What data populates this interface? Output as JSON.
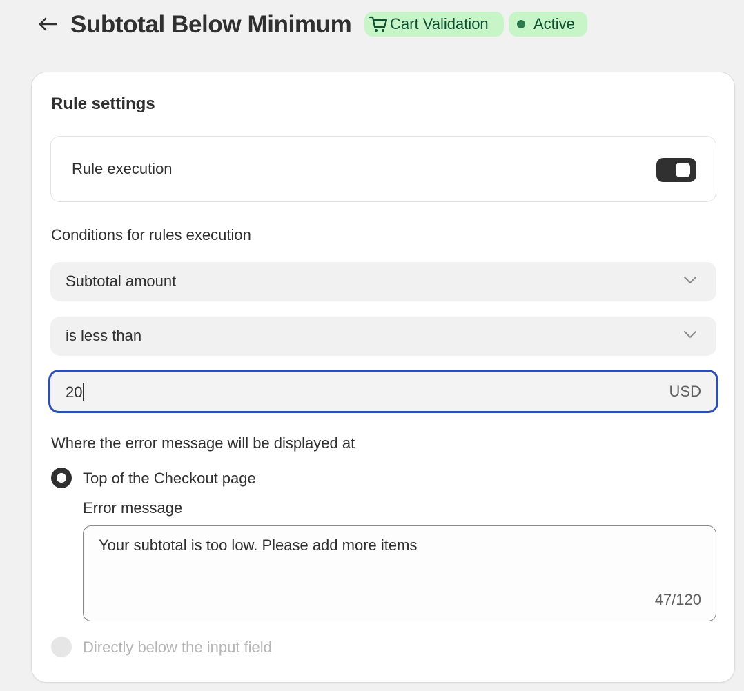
{
  "header": {
    "title": "Subtotal Below Minimum",
    "badges": {
      "type_label": "Cart Validation",
      "status_label": "Active"
    }
  },
  "card": {
    "title": "Rule settings",
    "rule_execution": {
      "label": "Rule execution",
      "enabled": true
    },
    "conditions": {
      "label": "Conditions for rules execution",
      "field_select": "Subtotal amount",
      "operator_select": "is less than",
      "amount_value": "20",
      "amount_suffix": "USD"
    },
    "display": {
      "label": "Where the error message will be displayed at",
      "options": [
        {
          "label": "Top of the Checkout page",
          "selected": true
        },
        {
          "label": "Directly below the input field",
          "selected": false
        }
      ],
      "error_message_label": "Error message",
      "error_message_value": "Your subtotal is too low. Please add more items",
      "char_counter": "47/120"
    }
  },
  "colors": {
    "badge_bg": "#c8f5c8",
    "badge_text": "#0c5132",
    "focus_ring": "#2c4fb0",
    "toggle_on": "#303030"
  }
}
